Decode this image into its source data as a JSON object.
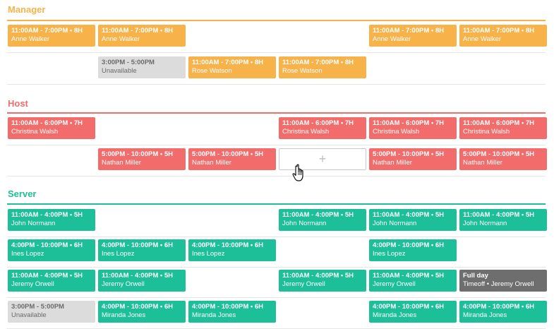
{
  "colors": {
    "manager": "#f7b24a",
    "host": "#f26c6b",
    "server": "#1cbf98",
    "unavailable": "#dcdcdc",
    "timeoff": "#6e6e6e"
  },
  "add_slot_label": "+",
  "cursor_icon": "hand-pointer-icon",
  "sections": [
    {
      "name": "Manager",
      "rows": [
        [
          {
            "time": "11:00AM - 7:00PM • 8H",
            "name": "Anne Walker",
            "type": "manager"
          },
          {
            "time": "11:00AM - 7:00PM • 8H",
            "name": "Anne Walker",
            "type": "manager"
          },
          null,
          null,
          {
            "time": "11:00AM - 7:00PM • 8H",
            "name": "Anne Walker",
            "type": "manager"
          },
          {
            "time": "11:00AM - 7:00PM • 8H",
            "name": "Anne Walker",
            "type": "manager"
          }
        ],
        [
          null,
          {
            "time": "3:00PM - 5:00PM",
            "name": "Unavailable",
            "type": "unavailable"
          },
          {
            "time": "11:00AM - 7:00PM • 8H",
            "name": "Rose Watson",
            "type": "manager"
          },
          {
            "time": "11:00AM - 7:00PM • 8H",
            "name": "Rose Watson",
            "type": "manager"
          },
          null,
          null
        ]
      ]
    },
    {
      "name": "Host",
      "rows": [
        [
          {
            "time": "11:00AM - 6:00PM • 7H",
            "name": "Christina Walsh",
            "type": "host"
          },
          null,
          null,
          {
            "time": "11:00AM - 6:00PM • 7H",
            "name": "Christina Walsh",
            "type": "host"
          },
          {
            "time": "11:00AM - 6:00PM • 7H",
            "name": "Christina Walsh",
            "type": "host"
          },
          {
            "time": "11:00AM - 6:00PM • 7H",
            "name": "Christina Walsh",
            "type": "host"
          }
        ],
        [
          null,
          {
            "time": "5:00PM - 10:00PM • 5H",
            "name": "Nathan Miller",
            "type": "host"
          },
          {
            "time": "5:00PM - 10:00PM • 5H",
            "name": "Nathan Miller",
            "type": "host"
          },
          {
            "type": "add"
          },
          {
            "time": "5:00PM - 10:00PM • 5H",
            "name": "Nathan Miller",
            "type": "host"
          },
          {
            "time": "5:00PM - 10:00PM • 5H",
            "name": "Nathan Miller",
            "type": "host"
          }
        ]
      ]
    },
    {
      "name": "Server",
      "rows": [
        [
          {
            "time": "11:00AM - 4:00PM • 5H",
            "name": "John Normann",
            "type": "server"
          },
          null,
          null,
          {
            "time": "11:00AM - 4:00PM • 5H",
            "name": "John Normann",
            "type": "server"
          },
          {
            "time": "11:00AM - 4:00PM • 5H",
            "name": "John Normann",
            "type": "server"
          },
          {
            "time": "11:00AM - 4:00PM • 5H",
            "name": "John Normann",
            "type": "server"
          }
        ],
        [
          {
            "time": "4:00PM - 10:00PM • 6H",
            "name": "Ines Lopez",
            "type": "server"
          },
          {
            "time": "4:00PM - 10:00PM • 6H",
            "name": "Ines Lopez",
            "type": "server"
          },
          {
            "time": "4:00PM - 10:00PM • 6H",
            "name": "Ines Lopez",
            "type": "server"
          },
          null,
          {
            "time": "4:00PM - 10:00PM • 6H",
            "name": "Ines Lopez",
            "type": "server"
          },
          null
        ],
        [
          {
            "time": "11:00AM - 4:00PM • 5H",
            "name": "Jeremy Orwell",
            "type": "server"
          },
          {
            "time": "11:00AM - 4:00PM • 5H",
            "name": "Jeremy Orwell",
            "type": "server"
          },
          null,
          {
            "time": "11:00AM - 4:00PM • 5H",
            "name": "Jeremy Orwell",
            "type": "server"
          },
          {
            "time": "11:00AM - 4:00PM • 5H",
            "name": "Jeremy Orwell",
            "type": "server"
          },
          {
            "time": "Full day",
            "name": "Timeoff • Jeremy Orwell",
            "type": "timeoff"
          }
        ],
        [
          {
            "time": "3:00PM - 5:00PM",
            "name": "Unavailable",
            "type": "unavailable"
          },
          {
            "time": "4:00PM - 10:00PM • 6H",
            "name": "Miranda Jones",
            "type": "server"
          },
          {
            "time": "4:00PM - 10:00PM • 6H",
            "name": "Miranda Jones",
            "type": "server"
          },
          null,
          {
            "time": "4:00PM - 10:00PM • 6H",
            "name": "Miranda Jones",
            "type": "server"
          },
          {
            "time": "4:00PM - 10:00PM • 6H",
            "name": "Miranda Jones",
            "type": "server"
          }
        ]
      ]
    }
  ]
}
